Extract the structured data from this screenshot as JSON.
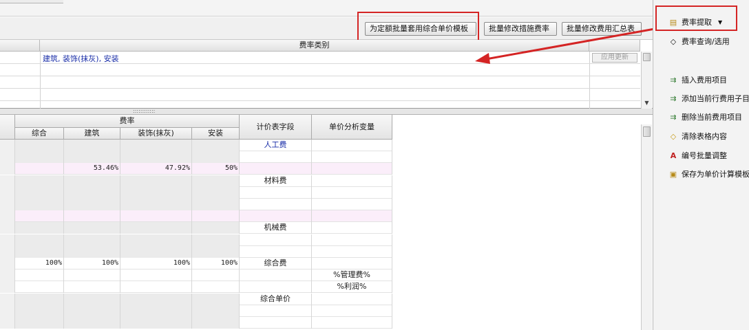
{
  "toolbar": {
    "btn_apply_template": "为定额批量套用综合单价模板",
    "btn_modify_measure_rate": "批量修改措施费率",
    "btn_modify_fee_summary": "批量修改费用汇总表"
  },
  "upper_grid": {
    "header": "费率类别",
    "row1_value": "建筑, 装饰(抹灰), 安装",
    "apply_update": "应用更新"
  },
  "lower_grid": {
    "header_rate": "费率",
    "col_headers": [
      "综合",
      "建筑",
      "装饰(抹灰)",
      "安装"
    ],
    "col_field": "计价表字段",
    "col_variable": "单价分析变量",
    "rows": [
      {
        "c1": "",
        "c2": "",
        "c3": "",
        "c4": "",
        "field": "人工费",
        "var": ""
      },
      {
        "c1": "",
        "c2": "",
        "c3": "",
        "c4": "",
        "field": "",
        "var": ""
      },
      {
        "c1": "",
        "c2": "53.46%",
        "c3": "47.92%",
        "c4": "50%",
        "field": "",
        "var": ""
      },
      {
        "c1": "",
        "c2": "",
        "c3": "",
        "c4": "",
        "field": "材料费",
        "var": ""
      },
      {
        "c1": "",
        "c2": "",
        "c3": "",
        "c4": "",
        "field": "",
        "var": ""
      },
      {
        "c1": "",
        "c2": "",
        "c3": "",
        "c4": "",
        "field": "",
        "var": ""
      },
      {
        "c1": "",
        "c2": "",
        "c3": "",
        "c4": "",
        "field": "",
        "var": ""
      },
      {
        "c1": "",
        "c2": "",
        "c3": "",
        "c4": "",
        "field": "机械费",
        "var": ""
      },
      {
        "c1": "",
        "c2": "",
        "c3": "",
        "c4": "",
        "field": "",
        "var": ""
      },
      {
        "c1": "",
        "c2": "",
        "c3": "",
        "c4": "",
        "field": "",
        "var": ""
      },
      {
        "c1": "100%",
        "c2": "100%",
        "c3": "100%",
        "c4": "100%",
        "field": "综合费",
        "var": ""
      },
      {
        "c1": "",
        "c2": "",
        "c3": "",
        "c4": "",
        "field": "",
        "var": "%管理费%"
      },
      {
        "c1": "",
        "c2": "",
        "c3": "",
        "c4": "",
        "field": "",
        "var": "%利润%"
      },
      {
        "c1": "",
        "c2": "",
        "c3": "",
        "c4": "",
        "field": "综合单价",
        "var": ""
      },
      {
        "c1": "",
        "c2": "",
        "c3": "",
        "c4": "",
        "field": "",
        "var": ""
      },
      {
        "c1": "",
        "c2": "",
        "c3": "",
        "c4": "",
        "field": "",
        "var": ""
      }
    ]
  },
  "right_panel": {
    "fee_extract": "费率提取",
    "fee_query": "费率查询/选用",
    "insert_fee_item": "插入费用项目",
    "add_child_item": "添加当前行费用子目",
    "delete_fee_item": "删除当前费用项目",
    "clear_cells": "清除表格内容",
    "renumber": "编号批量调整",
    "save_template": "保存为单价计算模板"
  },
  "colors": {
    "annotation_red": "#d42424",
    "link_blue": "#1a2ea8",
    "pink_row": "#fbeefa",
    "gray_row": "#ebebeb"
  },
  "icons": {
    "fee_extract": "folder-extract-icon",
    "fee_query": "eraser-tag-icon",
    "insert": "insert-row-icon",
    "add_child": "add-child-row-icon",
    "delete": "delete-row-icon",
    "clear": "eraser-icon",
    "renumber": "text-a-icon",
    "save": "save-template-icon"
  }
}
